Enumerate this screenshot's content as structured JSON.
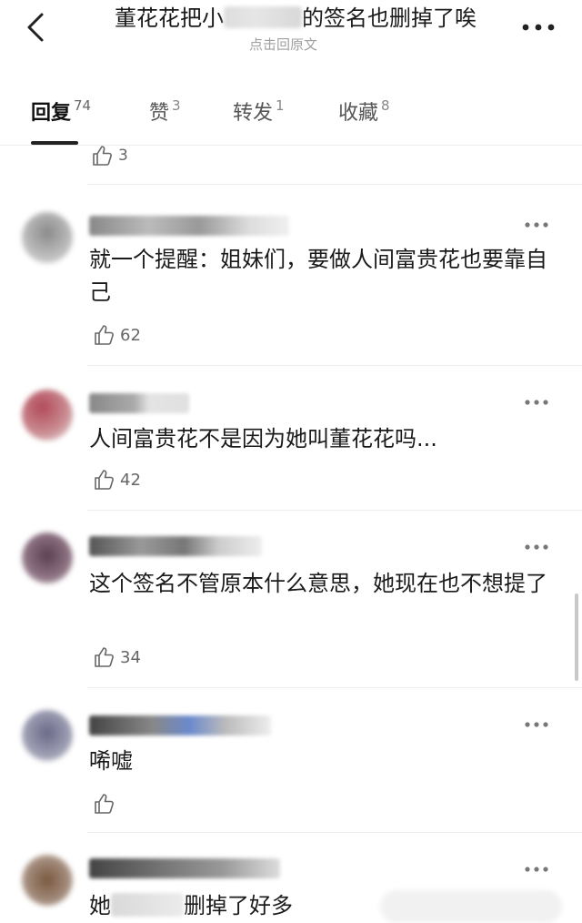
{
  "header": {
    "title_prefix": "董花花把小",
    "title_suffix": "的签名也删掉了唉",
    "subtitle": "点击回原文",
    "back_icon": "chevron-left-icon",
    "more_icon": "more-horizontal-icon"
  },
  "tabs": [
    {
      "label": "回复",
      "count": "74",
      "active": true
    },
    {
      "label": "赞",
      "count": "3",
      "active": false
    },
    {
      "label": "转发",
      "count": "1",
      "active": false
    },
    {
      "label": "收藏",
      "count": "8",
      "active": false
    }
  ],
  "prev_like": "3",
  "comments": [
    {
      "text": "就一个提醒：姐妹们，要做人间富贵花也要靠自己",
      "likes": "62"
    },
    {
      "text": "人间富贵花不是因为她叫董花花吗...",
      "likes": "42"
    },
    {
      "text": "这个签名不管原本什么意思，她现在也不想提了",
      "likes": "34"
    },
    {
      "text": "唏嘘",
      "likes": ""
    },
    {
      "text_prefix": "她",
      "text_suffix": "删掉了好多",
      "likes": ""
    }
  ],
  "colors": {
    "text": "#1a1a1a",
    "muted": "#666666",
    "subtitle": "#a0a0a0",
    "divider": "#ececec"
  }
}
